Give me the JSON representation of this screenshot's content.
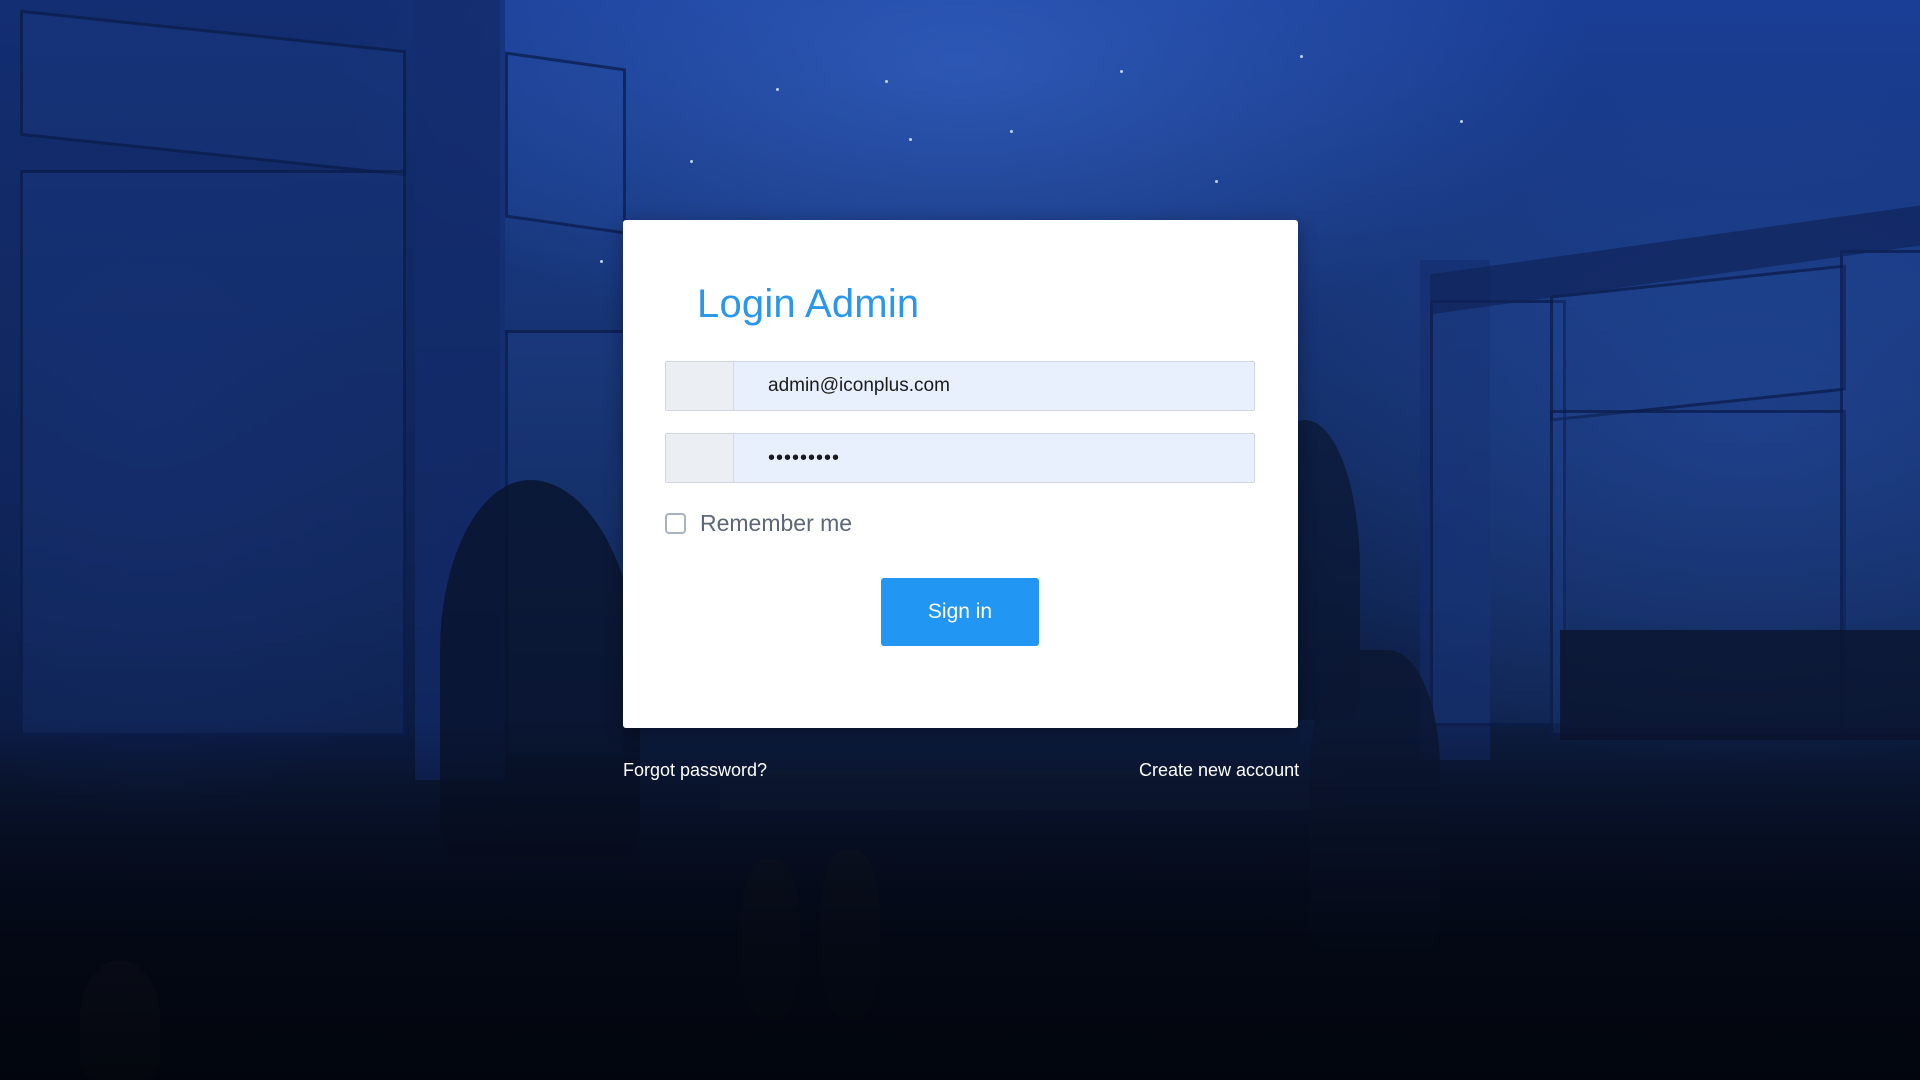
{
  "login": {
    "title": "Login Admin",
    "email_value": "admin@iconplus.com",
    "password_value": "•••••••••",
    "remember_label": "Remember me",
    "remember_checked": false,
    "signin_label": "Sign in"
  },
  "footer": {
    "forgot_password": "Forgot password?",
    "create_account": "Create new account"
  },
  "colors": {
    "accent": "#2196f3",
    "title": "#2a97ea",
    "input_bg": "#e8f0fe"
  }
}
